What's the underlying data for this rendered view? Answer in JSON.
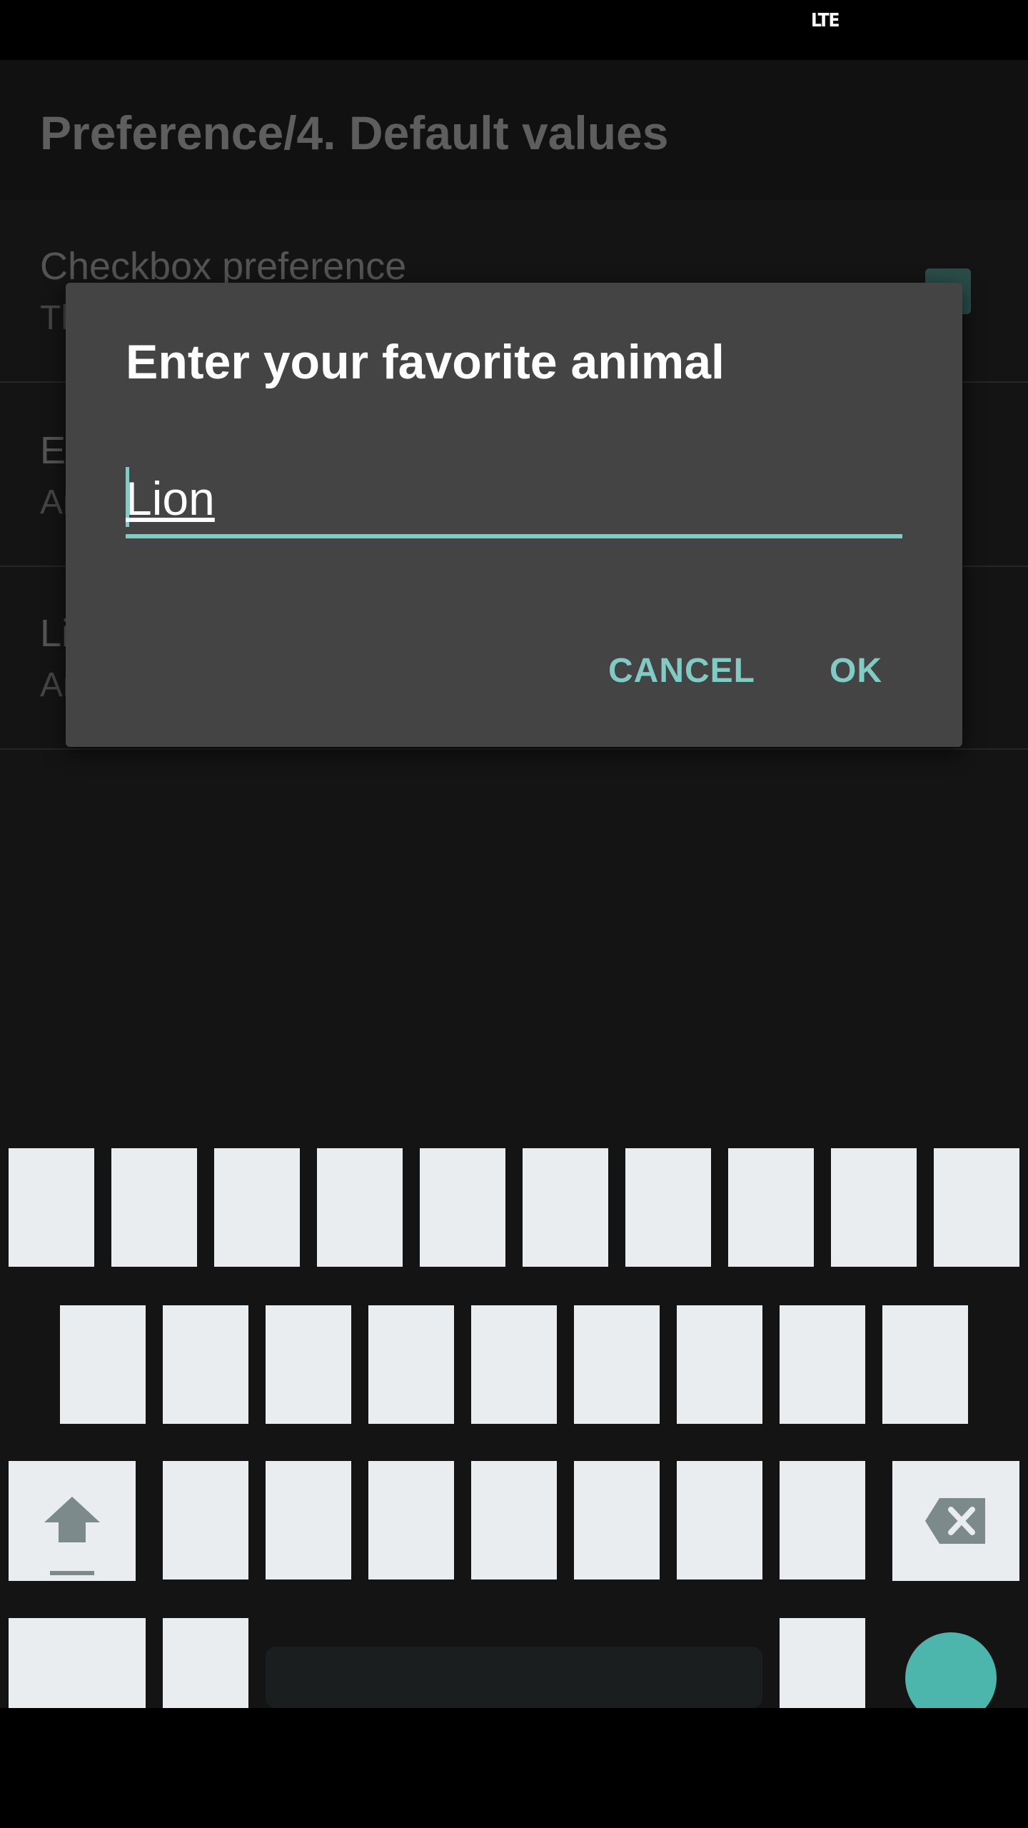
{
  "status_bar": {
    "network": "LTE"
  },
  "toolbar": {
    "title": "Preference/4. Default values"
  },
  "preferences": [
    {
      "title": "Checkbox preference",
      "summary": "Th"
    },
    {
      "title": "Ed",
      "summary": "An"
    },
    {
      "title": "Li",
      "summary": "An"
    }
  ],
  "dialog": {
    "title": "Enter your favorite animal",
    "input_value": "Lion",
    "cancel_label": "CANCEL",
    "ok_label": "OK"
  },
  "colors": {
    "accent": "#80cbc4",
    "enter_key": "#4db6ac",
    "dialog_bg": "#444444",
    "key_bg": "#e9edf0"
  },
  "keyboard": {
    "icons": [
      "shift-icon",
      "backspace-icon"
    ]
  }
}
